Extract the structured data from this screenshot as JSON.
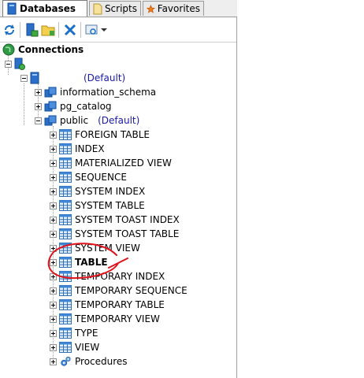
{
  "tabs": [
    {
      "label": "Databases",
      "icon": "database-icon",
      "active": true
    },
    {
      "label": "Scripts",
      "icon": "scripts-icon",
      "active": false
    },
    {
      "label": "Favorites",
      "icon": "star-icon",
      "active": false
    }
  ],
  "toolbar": {
    "buttons": [
      "refresh-icon",
      "new-connection-icon",
      "new-folder-icon",
      "disconnect-icon",
      "filter-icon",
      "dropdown-arrow-icon"
    ]
  },
  "tree": {
    "root_label": "Connections",
    "database_default": "(Default)",
    "schemas": [
      {
        "label": "information_schema"
      },
      {
        "label": "pg_catalog"
      },
      {
        "label": "public",
        "suffix": "(Default)"
      }
    ],
    "object_types": [
      {
        "label": "FOREIGN TABLE"
      },
      {
        "label": "INDEX"
      },
      {
        "label": "MATERIALIZED VIEW"
      },
      {
        "label": "SEQUENCE"
      },
      {
        "label": "SYSTEM INDEX"
      },
      {
        "label": "SYSTEM TABLE"
      },
      {
        "label": "SYSTEM TOAST INDEX"
      },
      {
        "label": "SYSTEM TOAST TABLE"
      },
      {
        "label": "SYSTEM VIEW"
      },
      {
        "label": "TABLE",
        "highlighted": true
      },
      {
        "label": "TEMPORARY INDEX"
      },
      {
        "label": "TEMPORARY SEQUENCE"
      },
      {
        "label": "TEMPORARY TABLE"
      },
      {
        "label": "TEMPORARY VIEW"
      },
      {
        "label": "TYPE"
      },
      {
        "label": "VIEW"
      },
      {
        "label": "Procedures",
        "icon": "procedures-gear-icon"
      }
    ]
  },
  "colors": {
    "default_text": "#1a1aa8",
    "annotation": "#e0141c"
  }
}
